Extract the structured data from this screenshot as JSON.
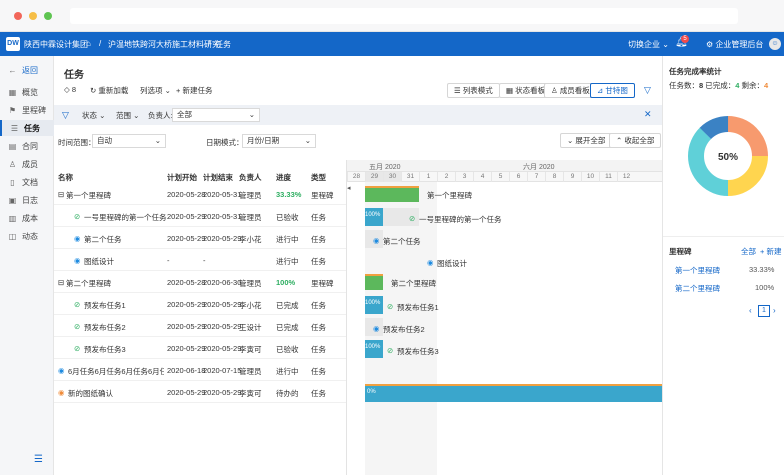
{
  "app": {
    "logo": "DW",
    "company": "陕西中霖设计集团",
    "breadcrumb_project": "沪温地铁跨河大桥施工材料研究",
    "breadcrumb_sep": "/",
    "breadcrumb_page": "任务",
    "switch_company": "切换企业",
    "notif_count": "5",
    "admin": "企业管理后台"
  },
  "sidebar": {
    "back": "返回",
    "items": [
      {
        "label": "概览"
      },
      {
        "label": "里程碑"
      },
      {
        "label": "任务"
      },
      {
        "label": "合同"
      },
      {
        "label": "成员"
      },
      {
        "label": "文档"
      },
      {
        "label": "日志"
      },
      {
        "label": "成本"
      },
      {
        "label": "动态"
      }
    ]
  },
  "toolbar": {
    "title": "任务",
    "tag_count": "8",
    "reload": "重新加载",
    "columns": "列选项",
    "new_task": "新建任务",
    "views": [
      "列表模式",
      "状态看板",
      "成员看板",
      "甘特图"
    ]
  },
  "filters": {
    "status": "状态",
    "range": "范围",
    "assignee_label": "负责人:",
    "assignee_value": "全部",
    "time_range_label": "时间范围：",
    "time_range_value": "自动",
    "date_mode_label": "日期模式：",
    "date_mode_value": "月份/日期",
    "expand_all": "展开全部",
    "collapse_all": "收起全部"
  },
  "table": {
    "headers": [
      "名称",
      "计划开始",
      "计划结束",
      "负责人",
      "进度",
      "类型"
    ],
    "rows": [
      {
        "name": "第一个里程碑",
        "start": "2020-05-28",
        "end": "2020-05-31",
        "owner": "管理员",
        "progress": "33.33%",
        "type": "里程碑"
      },
      {
        "name": "一号里程碑的第一个任务",
        "start": "2020-05-29",
        "end": "2020-05-31",
        "owner": "管理员",
        "progress": "已验收",
        "type": "任务"
      },
      {
        "name": "第二个任务",
        "start": "2020-05-29",
        "end": "2020-05-29",
        "owner": "李小花",
        "progress": "进行中",
        "type": "任务"
      },
      {
        "name": "图纸设计",
        "start": "-",
        "end": "-",
        "owner": "",
        "progress": "进行中",
        "type": "任务"
      },
      {
        "name": "第二个里程碑",
        "start": "2020-05-28",
        "end": "2020-06-30",
        "owner": "管理员",
        "progress": "100%",
        "type": "里程碑"
      },
      {
        "name": "预发布任务1",
        "start": "2020-05-29",
        "end": "2020-05-29",
        "owner": "李小花",
        "progress": "已完成",
        "type": "任务"
      },
      {
        "name": "预发布任务2",
        "start": "2020-05-29",
        "end": "2020-05-29",
        "owner": "王设计",
        "progress": "已完成",
        "type": "任务"
      },
      {
        "name": "预发布任务3",
        "start": "2020-05-29",
        "end": "2020-05-29",
        "owner": "李寅可",
        "progress": "已验收",
        "type": "任务"
      },
      {
        "name": "6月任务6月任务6月任务6月任务",
        "start": "2020-06-18",
        "end": "2020-07-15",
        "owner": "管理员",
        "progress": "进行中",
        "type": "任务"
      },
      {
        "name": "新的图纸确认",
        "start": "2020-05-29",
        "end": "2020-05-29",
        "owner": "李寅可",
        "progress": "待办的",
        "type": "任务"
      }
    ]
  },
  "gantt": {
    "month1": "五月 2020",
    "month2": "六月 2020",
    "days": [
      "28",
      "29",
      "30",
      "31",
      "1",
      "2",
      "3",
      "4",
      "5",
      "6",
      "7",
      "8",
      "9",
      "10",
      "11",
      "12"
    ],
    "labels": [
      "第一个里程碑",
      "一号里程碑的第一个任务",
      "第二个任务",
      "图纸设计",
      "第二个里程碑",
      "预发布任务1",
      "预发布任务2",
      "预发布任务3"
    ],
    "pct_100": "100%",
    "pct_0": "0%"
  },
  "right": {
    "title": "任务完成率统计",
    "summary_prefix": "任务数：",
    "total": "8",
    "done_label": "已完成：",
    "done": "4",
    "remain_label": "剩余：",
    "remain": "4",
    "donut_center": "50%",
    "donut_colors": [
      "#f79a6e",
      "#ffd54f",
      "#5fd0d8",
      "#3b82c4"
    ],
    "milestone_title": "里程碑",
    "all": "全部",
    "new": "+ 新建",
    "milestones": [
      {
        "name": "第一个里程碑",
        "pct": "33.33%"
      },
      {
        "name": "第二个里程碑",
        "pct": "100%"
      }
    ],
    "page": "1"
  }
}
